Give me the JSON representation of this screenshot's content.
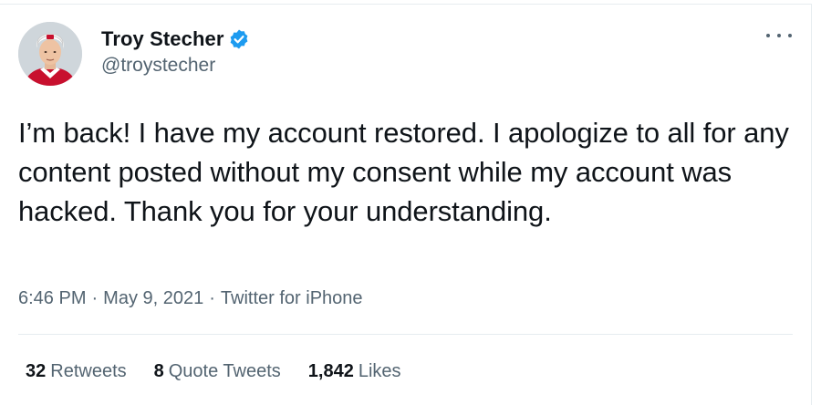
{
  "author": {
    "display_name": "Troy Stecher",
    "handle": "@troystecher",
    "verified": true
  },
  "tweet": {
    "text": "I’m back! I have my account restored. I apologize to all for any content posted without my consent while my account was hacked. Thank you for your understanding.",
    "time": "6:46 PM",
    "separator": "·",
    "date": "May 9, 2021",
    "source": "Twitter for iPhone"
  },
  "stats": [
    {
      "count": "32",
      "label": "Retweets"
    },
    {
      "count": "8",
      "label": "Quote Tweets"
    },
    {
      "count": "1,842",
      "label": "Likes"
    }
  ],
  "colors": {
    "verified_badge": "#1d9bf0",
    "secondary_text": "#536471",
    "primary_text": "#0f1419",
    "divider": "#e6ecf0"
  },
  "icons": {
    "verified": "verified-badge-icon",
    "more": "more-options-icon"
  }
}
